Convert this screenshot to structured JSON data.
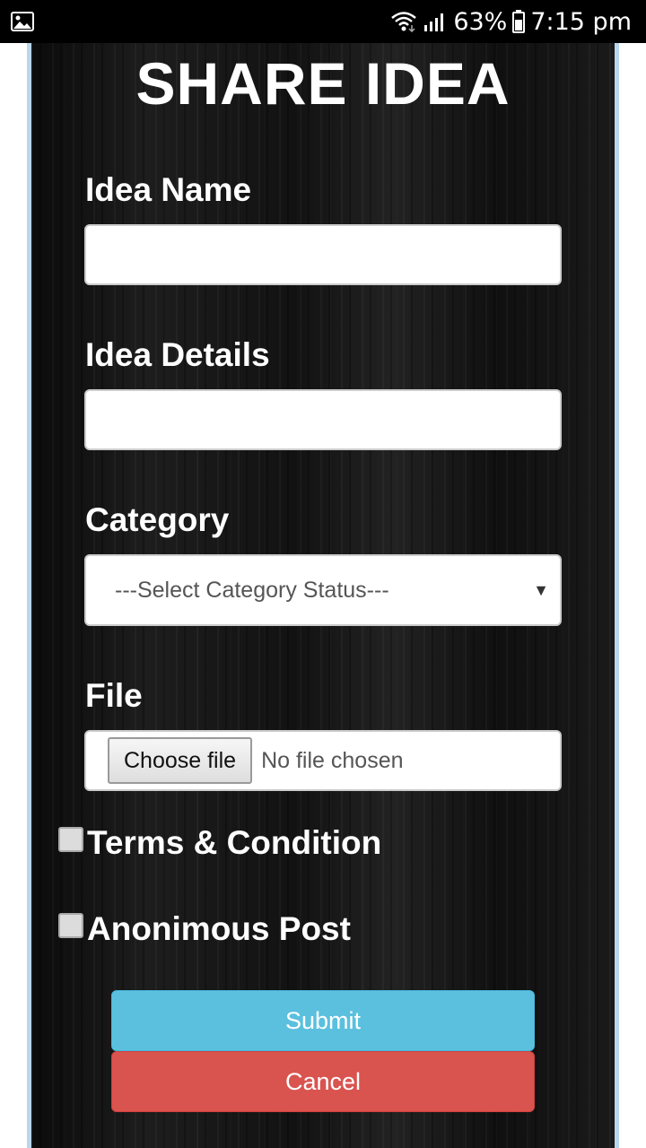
{
  "status_bar": {
    "battery": "63%",
    "time": "7:15 pm",
    "icons": [
      "gallery-icon",
      "wifi-icon",
      "signal-icon",
      "battery-icon"
    ]
  },
  "form": {
    "title": "SHARE IDEA",
    "idea_name": {
      "label": "Idea Name",
      "value": ""
    },
    "idea_details": {
      "label": "Idea Details",
      "value": ""
    },
    "category": {
      "label": "Category",
      "selected": "---Select Category Status---"
    },
    "file": {
      "label": "File",
      "button": "Choose file",
      "status": "No file chosen"
    },
    "terms": {
      "label": "Terms & Condition",
      "checked": false
    },
    "anonymous": {
      "label": "Anonimous Post",
      "checked": false
    },
    "submit_label": "Submit",
    "cancel_label": "Cancel"
  },
  "colors": {
    "status_bar": "#000000",
    "page_border": "#b9d6ec",
    "panel": "#151515",
    "submit": "#5bc0de",
    "cancel": "#d9534f"
  }
}
